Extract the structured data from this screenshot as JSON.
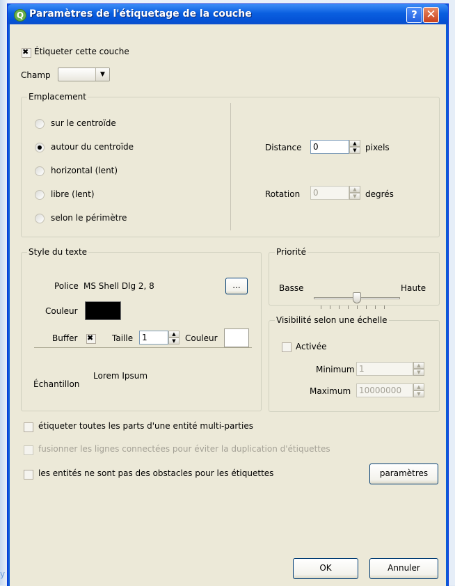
{
  "window": {
    "title": "Paramètres de l'étiquetage de la couche",
    "help": "?",
    "close": "✕"
  },
  "top": {
    "label_layer": "Étiqueter cette couche",
    "field_label": "Champ",
    "field_value": ""
  },
  "placement": {
    "title": "Emplacement",
    "options": [
      "sur le centroïde",
      "autour du centroïde",
      "horizontal (lent)",
      "libre (lent)",
      "selon le périmètre"
    ],
    "selected": 1,
    "distance_label": "Distance",
    "distance_value": "0",
    "distance_unit": "pixels",
    "rotation_label": "Rotation",
    "rotation_value": "0",
    "rotation_unit": "degrés"
  },
  "text_style": {
    "title": "Style du texte",
    "font_label": "Police",
    "font_value": "MS Shell Dlg 2, 8",
    "font_button": "...",
    "color_label": "Couleur",
    "color_value": "#000000",
    "buffer_label": "Buffer",
    "size_label": "Taille",
    "size_value": "1",
    "buffer_color_label": "Couleur",
    "buffer_color_value": "#ffffff",
    "sample_label": "Échantillon",
    "sample_text": "Lorem Ipsum"
  },
  "priority": {
    "title": "Priorité",
    "low": "Basse",
    "high": "Haute",
    "level": 0.5
  },
  "scale_visibility": {
    "title": "Visibilité selon une échelle",
    "enabled_label": "Activée",
    "min_label": "Minimum",
    "min_value": "1",
    "max_label": "Maximum",
    "max_value": "10000000"
  },
  "options": {
    "multipart": "étiqueter toutes les parts d'une entité multi-parties",
    "merge": "fusionner les lignes connectées pour éviter la duplication d'étiquettes",
    "obstacles": "les entités ne sont pas des obstacles pour les étiquettes",
    "params_button": "paramètres"
  },
  "footer": {
    "ok": "OK",
    "cancel": "Annuler"
  },
  "side_text": "y"
}
